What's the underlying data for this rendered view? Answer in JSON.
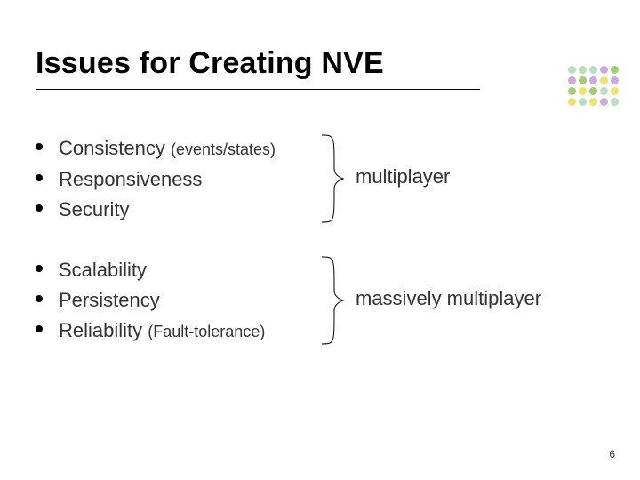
{
  "title": "Issues for Creating NVE",
  "groups": [
    {
      "label": "multiplayer",
      "items": [
        {
          "text": "Consistency ",
          "qualifier": "(events/states)"
        },
        {
          "text": "Responsiveness"
        },
        {
          "text": "Security"
        }
      ]
    },
    {
      "label": "massively multiplayer",
      "items": [
        {
          "text": "Scalability"
        },
        {
          "text": "Persistency"
        },
        {
          "text": "Reliability ",
          "qualifier": "(Fault-tolerance)"
        }
      ]
    }
  ],
  "page_number": "6"
}
